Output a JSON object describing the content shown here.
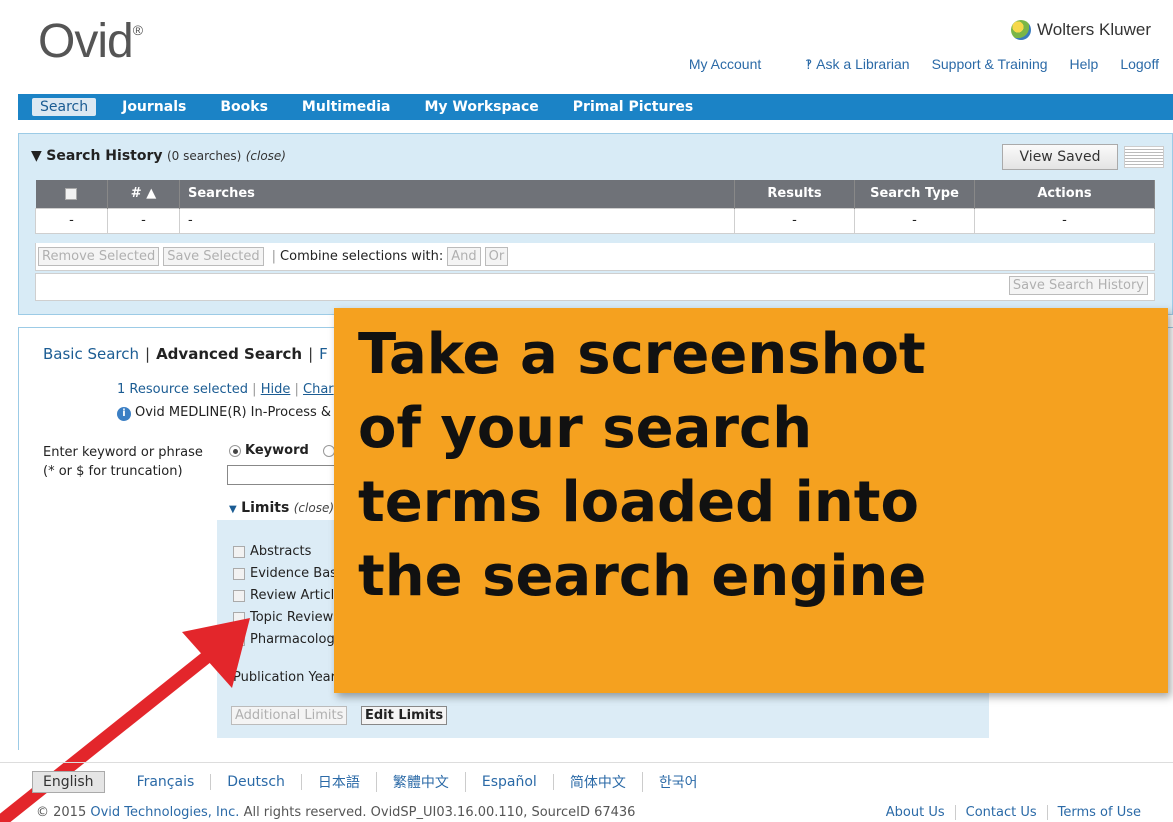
{
  "header": {
    "logo": "Ovid",
    "logo_mark": "®",
    "brand": "Wolters Kluwer",
    "links": {
      "my_account": "My Account",
      "ask_librarian": "Ask a Librarian",
      "support": "Support & Training",
      "help": "Help",
      "logoff": "Logoff"
    }
  },
  "nav": [
    "Search",
    "Journals",
    "Books",
    "Multimedia",
    "My Workspace",
    "Primal Pictures"
  ],
  "history": {
    "title": "Search History",
    "count": "(0 searches)",
    "close": "(close)",
    "view_saved": "View Saved",
    "columns": {
      "num": "# ▲",
      "searches": "Searches",
      "results": "Results",
      "type": "Search Type",
      "actions": "Actions"
    },
    "empty_row": {
      "check": "-",
      "num": "-",
      "searches": "-",
      "results": "-",
      "type": "-",
      "actions": "-"
    },
    "remove_selected": "Remove Selected",
    "save_selected": "Save Selected",
    "combine": "Combine selections with:",
    "and": "And",
    "or": "Or",
    "save_history": "Save Search History"
  },
  "search": {
    "tabs": {
      "basic": "Basic Search",
      "advanced": "Advanced Search",
      "partial": "F"
    },
    "resource": {
      "selected": "1 Resource selected",
      "hide": "Hide",
      "change": "Char"
    },
    "database": "Ovid MEDLINE(R) In-Process &",
    "kw_label_1": "Enter keyword or phrase",
    "kw_label_2": "(* or $ for truncation)",
    "keyword": "Keyword",
    "limits": "Limits",
    "limits_close": "(close)",
    "limit_items": [
      "Abstracts",
      "Evidence Bas",
      "Review Articl",
      "Topic Review",
      "Pharmacologi"
    ],
    "pub_year": "Publication Year",
    "additional_limits": "Additional Limits",
    "edit_limits": "Edit Limits"
  },
  "overlay": {
    "text": "Take a screenshot\nof your search\nterms loaded into\nthe search engine",
    "color": "#f5a11f"
  },
  "arrow_color": "#e3262b",
  "footer": {
    "languages": [
      "English",
      "Français",
      "Deutsch",
      "日本語",
      "繁體中文",
      "Español",
      "简体中文",
      "한국어"
    ],
    "copyright_pre": "© 2015",
    "copyright_link": "Ovid Technologies, Inc.",
    "copyright_post": "All rights reserved.   OvidSP_UI03.16.00.110, SourceID 67436",
    "links": [
      "About Us",
      "Contact Us",
      "Terms of Use"
    ]
  }
}
